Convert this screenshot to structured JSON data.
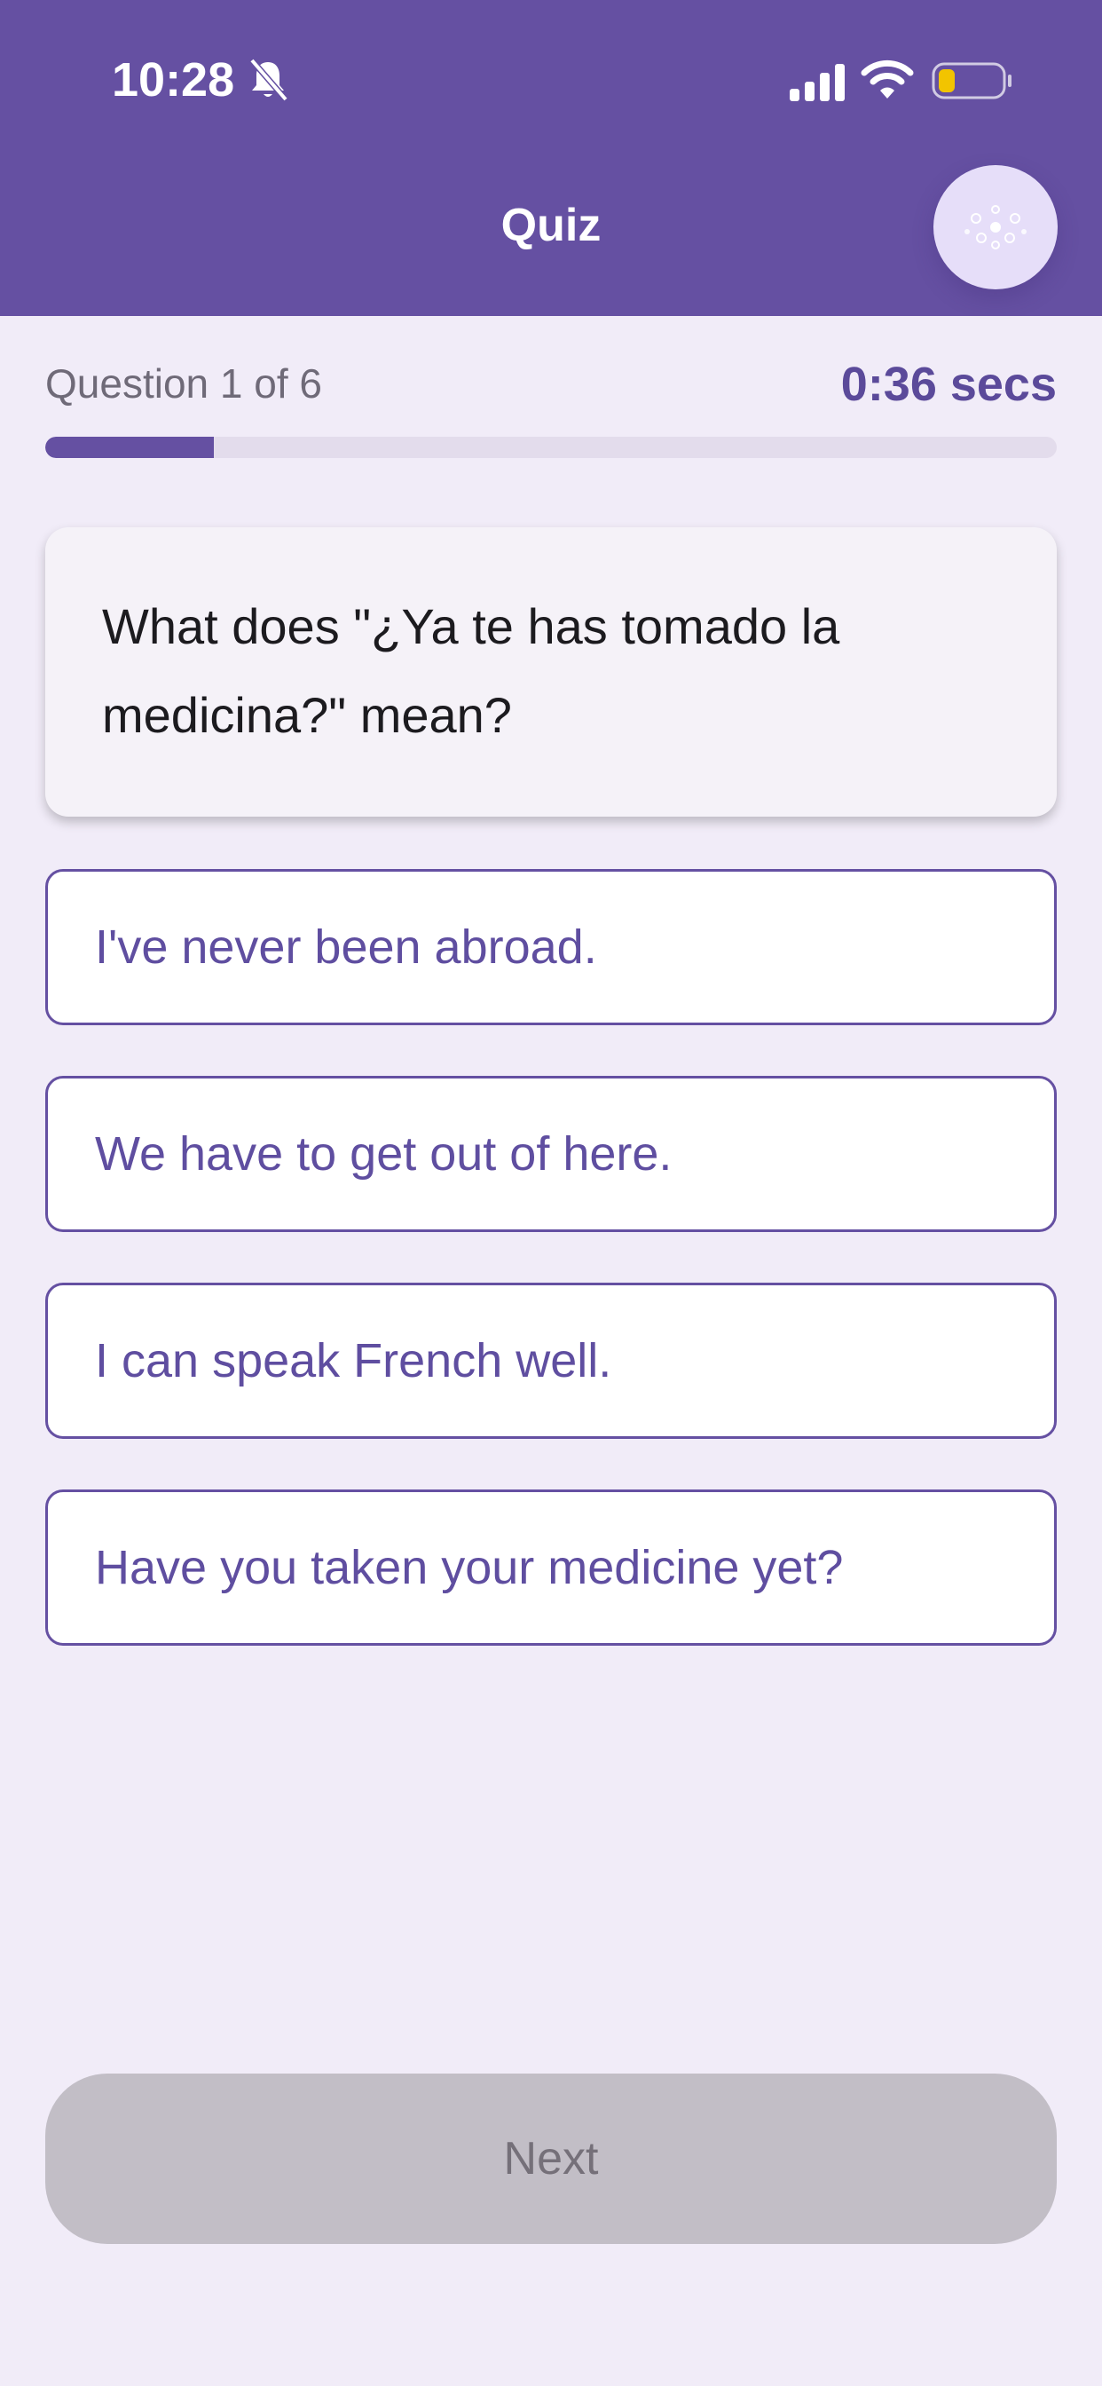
{
  "status_bar": {
    "time": "10:28",
    "battery_color": "#f2c400"
  },
  "header": {
    "title": "Quiz",
    "avatar_icon": "avatar-icon"
  },
  "progress": {
    "counter": "Question 1 of 6",
    "timer": "0:36 secs",
    "fraction": 0.1667
  },
  "question": {
    "text": "What does \"¿Ya te has tomado la medicina?\" mean?"
  },
  "options": [
    {
      "label": "I've never been abroad."
    },
    {
      "label": "We have to get out of here."
    },
    {
      "label": "I can speak French well."
    },
    {
      "label": "Have you taken your medicine yet?"
    }
  ],
  "footer": {
    "next_label": "Next"
  },
  "colors": {
    "primary": "#6550a2",
    "background": "#f1ecf8",
    "disabled_button": "#c2bec6"
  }
}
